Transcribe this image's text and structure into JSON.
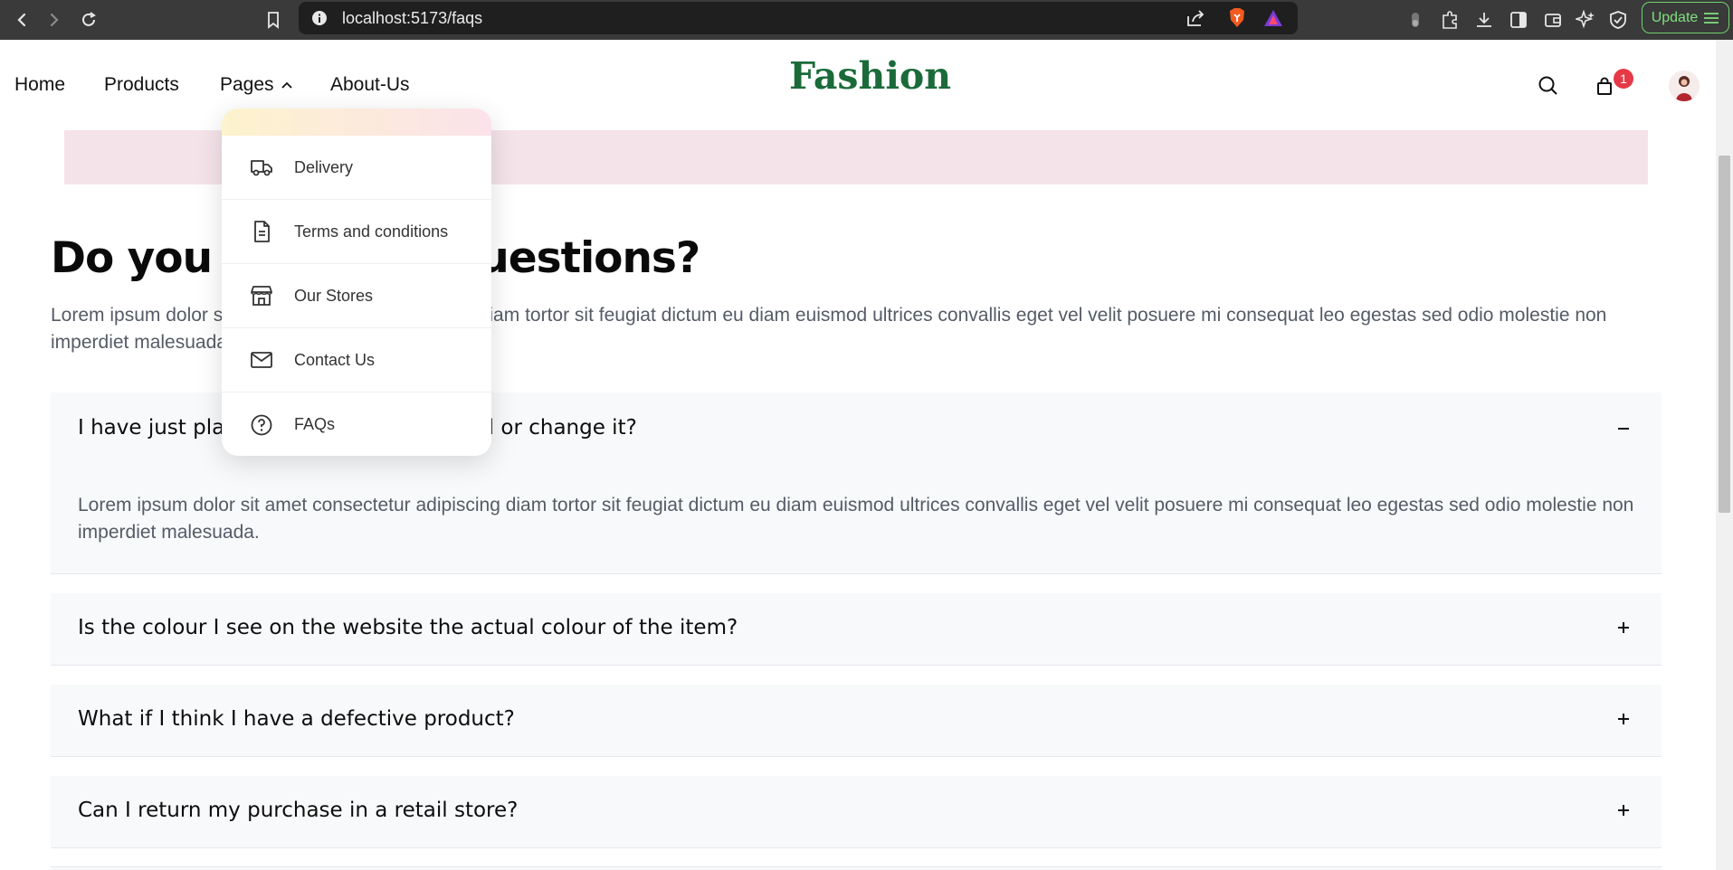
{
  "browser": {
    "url": "localhost:5173/faqs",
    "update_label": "Update"
  },
  "header": {
    "nav": [
      "Home",
      "Products",
      "Pages",
      "About-Us"
    ],
    "brand": "Fashion",
    "cart_count": "1"
  },
  "dropdown": {
    "items": [
      {
        "label": "Delivery",
        "icon": "truck-icon"
      },
      {
        "label": "Terms and conditions",
        "icon": "document-icon"
      },
      {
        "label": "Our Stores",
        "icon": "store-icon"
      },
      {
        "label": "Contact Us",
        "icon": "mail-icon"
      },
      {
        "label": "FAQs",
        "icon": "help-circle-icon"
      }
    ]
  },
  "main": {
    "title": "Do you have any questions?",
    "intro": "Lorem ipsum dolor sit amet consectetur adipiscing diam tortor sit feugiat dictum eu diam euismod ultrices convallis eget vel velit posuere mi consequat leo egestas sed odio molestie non imperdiet malesuada.",
    "faqs": [
      {
        "question": "I have just placed an order, can I cancel or change it?",
        "answer": "Lorem ipsum dolor sit amet consectetur adipiscing diam tortor sit feugiat dictum eu diam euismod ultrices convallis eget vel velit posuere mi consequat leo egestas sed odio molestie non imperdiet malesuada.",
        "toggle": "−"
      },
      {
        "question": "Is the colour I see on the website the actual colour of the item?",
        "toggle": "+"
      },
      {
        "question": "What if I think I have a defective product?",
        "toggle": "+"
      },
      {
        "question": "Can I return my purchase in a retail store?",
        "toggle": "+"
      }
    ]
  },
  "colors": {
    "brand": "#1b6b3a",
    "badge": "#e53945",
    "band": "#f5e3ea"
  }
}
